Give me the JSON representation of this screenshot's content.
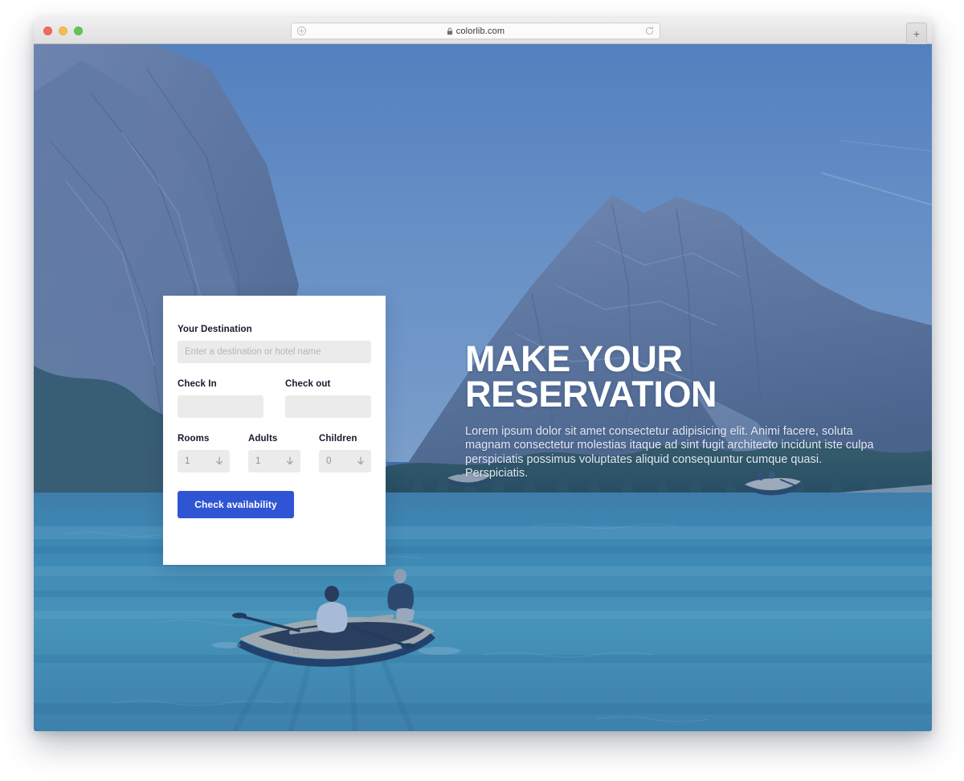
{
  "browser": {
    "traffic_lights": [
      "close",
      "minimize",
      "maximize"
    ],
    "url": "colorlib.com",
    "lock_icon": "lock-icon",
    "left_icon": "circle-plus-icon",
    "reload_icon": "reload-icon",
    "new_tab_label": "+",
    "colors": {
      "close": "#ee6a5f",
      "minimize": "#f5bd4f",
      "maximize": "#61c454"
    }
  },
  "hero": {
    "title": "MAKE YOUR RESERVATION",
    "subtitle": "Lorem ipsum dolor sit amet consectetur adipisicing elit. Animi facere, soluta magnam consectetur molestias itaque ad sint fugit architecto incidunt iste culpa perspiciatis possimus voluptates aliquid consequuntur cumque quasi. Perspiciatis.",
    "title_color": "#ffffff",
    "subtitle_color": "#e2e7f0",
    "overlay_color": "#2d55aa"
  },
  "booking_form": {
    "destination": {
      "label": "Your Destination",
      "placeholder": "Enter a destination or hotel name",
      "value": ""
    },
    "check_in": {
      "label": "Check In",
      "value": ""
    },
    "check_out": {
      "label": "Check out",
      "value": ""
    },
    "rooms": {
      "label": "Rooms",
      "value": "1",
      "icon": "chevron-down-icon"
    },
    "adults": {
      "label": "Adults",
      "value": "1",
      "icon": "chevron-down-icon"
    },
    "children": {
      "label": "Children",
      "value": "0",
      "icon": "chevron-down-icon"
    },
    "submit": {
      "label": "Check availability",
      "color": "#2f55d4"
    }
  }
}
